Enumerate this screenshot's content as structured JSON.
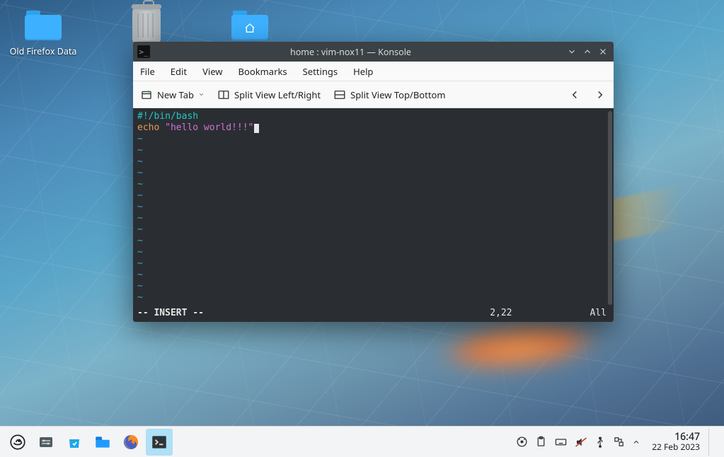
{
  "desktop": {
    "icons": [
      {
        "label": "Old Firefox Data",
        "kind": "folder"
      },
      {
        "label": "Trash",
        "kind": "trash"
      },
      {
        "label": "Home",
        "kind": "home-folder"
      }
    ]
  },
  "window": {
    "title": "home : vim-nox11 — Konsole",
    "menubar": [
      "File",
      "Edit",
      "View",
      "Bookmarks",
      "Settings",
      "Help"
    ],
    "toolbar": {
      "new_tab": "New Tab",
      "split_lr": "Split View Left/Right",
      "split_tb": "Split View Top/Bottom"
    },
    "terminal": {
      "shebang": "#!/bin/bash",
      "echo_kw": "echo",
      "echo_str": "\"hello world!!!\"",
      "tilde": "~",
      "tilde_rows": 15,
      "mode": "-- INSERT --",
      "position": "2,22",
      "extent": "All"
    }
  },
  "taskbar": {
    "launchers": [
      {
        "name": "app-launcher",
        "icon": "opensuse"
      },
      {
        "name": "system-settings",
        "icon": "sliders"
      },
      {
        "name": "discover",
        "icon": "bag"
      },
      {
        "name": "dolphin",
        "icon": "files"
      },
      {
        "name": "firefox",
        "icon": "firefox"
      },
      {
        "name": "konsole",
        "icon": "terminal",
        "active": true
      }
    ],
    "tray": [
      "media-icon",
      "clipboard-icon",
      "keyboard-icon",
      "volume-muted-icon",
      "usb-icon",
      "network-icon",
      "chevron-up-icon"
    ],
    "clock": {
      "time": "16:47",
      "date": "22 Feb 2023"
    },
    "watermark": ""
  }
}
